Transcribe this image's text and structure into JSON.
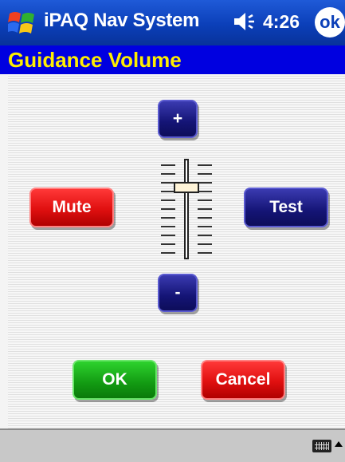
{
  "titlebar": {
    "app_title": "iPAQ Nav System",
    "time": "4:26",
    "ok_label": "ok",
    "start_icon": "windows-flag-icon",
    "speaker_icon": "speaker-icon"
  },
  "heading": {
    "text": "Guidance Volume"
  },
  "controls": {
    "plus_label": "+",
    "minus_label": "-",
    "mute_label": "Mute",
    "test_label": "Test",
    "ok_label": "OK",
    "cancel_label": "Cancel",
    "volume_level": 0.75
  },
  "bottombar": {
    "keyboard_icon": "keyboard-icon",
    "sip_icon": "up-arrow-icon"
  },
  "colors": {
    "title_blue": "#0b3fb8",
    "heading_blue": "#0000e0",
    "heading_text": "#ffee00",
    "button_blue": "#141475",
    "button_red": "#e01010",
    "button_green": "#129a12"
  }
}
